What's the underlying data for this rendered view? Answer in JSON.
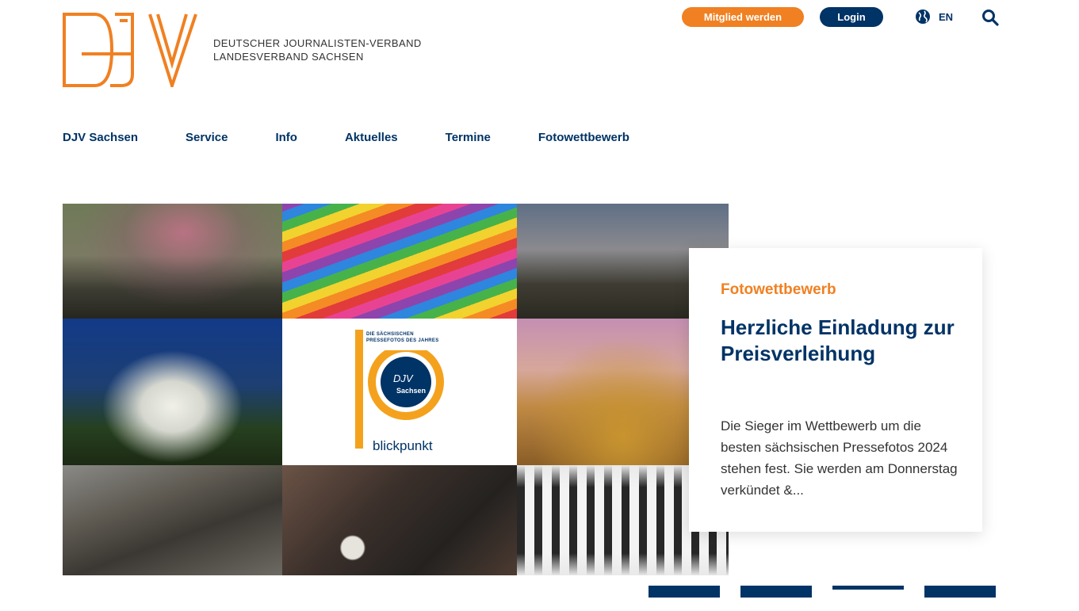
{
  "header": {
    "logo_text": "DJV",
    "org_line1": "DEUTSCHER JOURNALISTEN-VERBAND",
    "org_line2": "LANDESVERBAND SACHSEN",
    "member_button": "Mitglied werden",
    "login_button": "Login",
    "language_label": "EN",
    "icons": [
      "globe-icon",
      "search-icon"
    ]
  },
  "nav": {
    "items": [
      {
        "label": "DJV Sachsen"
      },
      {
        "label": "Service"
      },
      {
        "label": "Info"
      },
      {
        "label": "Aktuelles"
      },
      {
        "label": "Termine"
      },
      {
        "label": "Fotowettbewerb"
      }
    ]
  },
  "hero": {
    "badge_logo": {
      "top_text_line1": "DIE SÄCHSISCHEN",
      "top_text_line2": "PRESSEFOTOS DES JAHRES",
      "inner_logo": "DJV",
      "inner_sub": "Sachsen",
      "word": "blickpunkt"
    }
  },
  "card": {
    "kicker": "Fotowettbewerb",
    "title": "Herzliche Einladung zur Preisverleihung",
    "text": "Die Sieger im Wettbewerb um die besten sächsischen Pressefotos 2024 stehen fest. Sie werden am Donnerstag verkündet &..."
  },
  "slider": {
    "count": 4,
    "active_index": 3
  },
  "colors": {
    "brand_orange": "#f08022",
    "brand_blue": "#003366"
  }
}
